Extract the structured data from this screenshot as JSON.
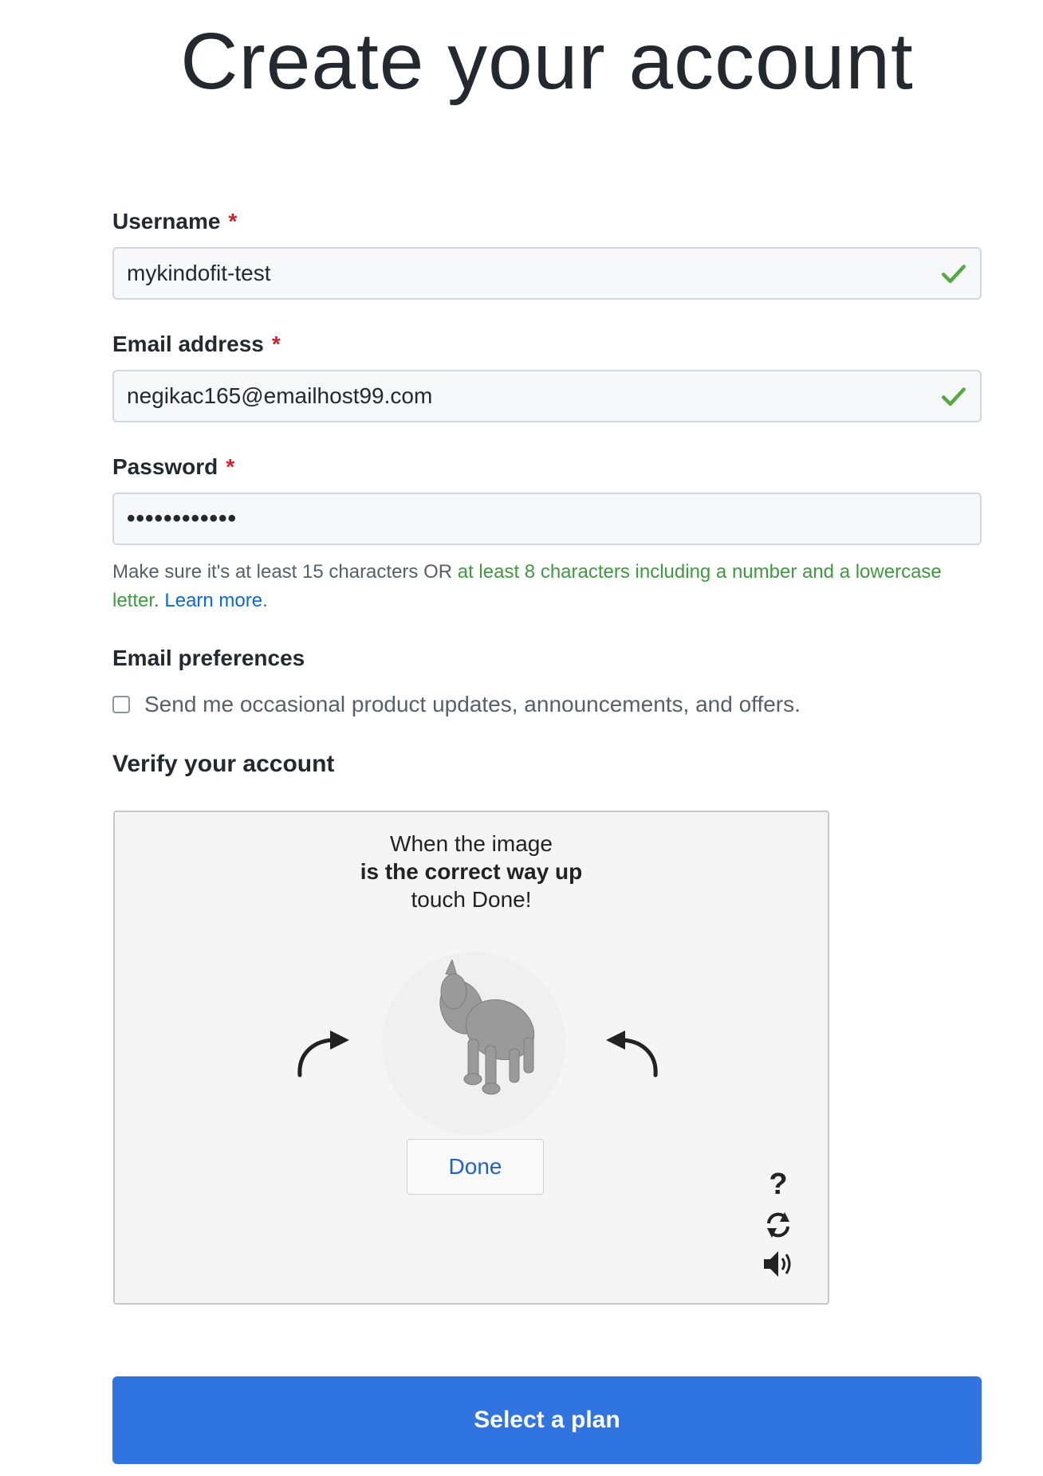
{
  "title": "Create your account",
  "username": {
    "label": "Username",
    "required_mark": "*",
    "value": "mykindofit-test"
  },
  "email": {
    "label": "Email address",
    "required_mark": "*",
    "value": "negikac165@emailhost99.com"
  },
  "password": {
    "label": "Password",
    "required_mark": "*",
    "masked_value": "••••••••••••",
    "hint_prefix": "Make sure it's at least 15 characters OR ",
    "hint_green": "at least 8 characters including a number and a lowercase letter",
    "hint_link": "Learn more",
    "hint_suffix": "."
  },
  "email_preferences": {
    "label": "Email preferences",
    "checkbox_text": "Send me occasional product updates, announcements, and offers.",
    "checked": false
  },
  "verify": {
    "label": "Verify your account",
    "instruction_line1": "When the image",
    "instruction_line2": "is the correct way up",
    "instruction_line3": "touch Done!",
    "done_label": "Done",
    "help_symbol": "?"
  },
  "submit_label": "Select a plan",
  "colors": {
    "valid": "#57a845",
    "primary": "#2f74e0",
    "required": "#cf222e",
    "link": "#0969da"
  }
}
